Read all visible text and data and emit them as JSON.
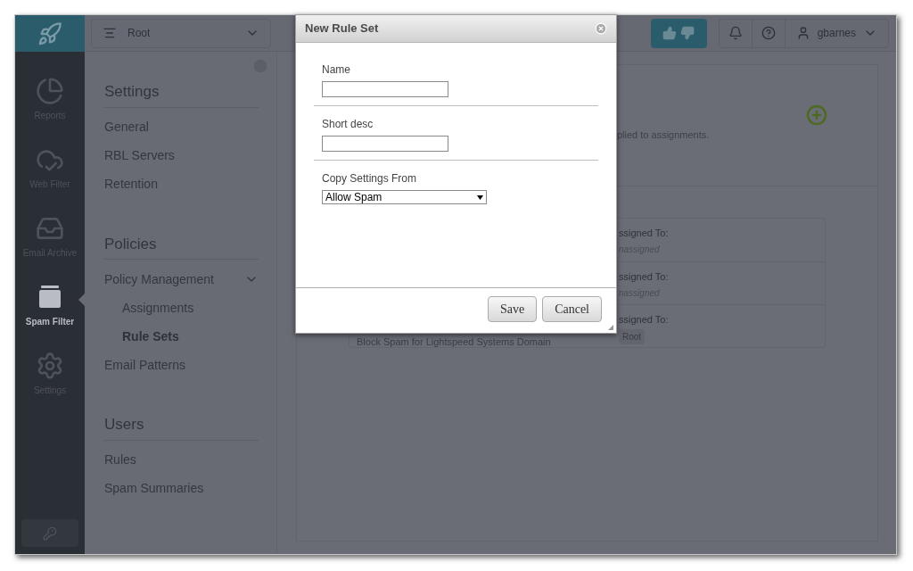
{
  "top_bar": {
    "org_selector": "Root",
    "user": "gbarnes"
  },
  "nav_rail": [
    {
      "label": "Reports",
      "kind": "pie",
      "selected": false
    },
    {
      "label": "Web Filter",
      "kind": "cloud",
      "selected": false
    },
    {
      "label": "Email Archive",
      "kind": "inbox",
      "selected": false
    },
    {
      "label": "Spam Filter",
      "kind": "mailbox",
      "selected": true
    },
    {
      "label": "Settings",
      "kind": "gear",
      "selected": false
    }
  ],
  "sidebar": {
    "sections": [
      {
        "title": "Settings",
        "items": [
          {
            "label": "General",
            "selected": false
          },
          {
            "label": "RBL Servers",
            "selected": false
          },
          {
            "label": "Retention",
            "selected": false
          }
        ]
      },
      {
        "title": "Policies",
        "items": [
          {
            "label": "Policy Management",
            "selected": false,
            "expanded": true,
            "children": [
              {
                "label": "Assignments",
                "selected": false
              },
              {
                "label": "Rule Sets",
                "selected": true
              }
            ]
          },
          {
            "label": "Email Patterns",
            "selected": false
          }
        ]
      },
      {
        "title": "Users",
        "items": [
          {
            "label": "Rules",
            "selected": false
          },
          {
            "label": "Spam Summaries",
            "selected": false
          }
        ]
      }
    ]
  },
  "content": {
    "description": "plied to assignments.",
    "rule_sets": [
      {
        "assigned_label": "ssigned To:",
        "assigned_value": "nassigned",
        "kind": "unassigned"
      },
      {
        "assigned_label": "ssigned To:",
        "assigned_value": "nassigned",
        "kind": "unassigned"
      },
      {
        "name": "Block Spam for Lightspeed Systems Domain",
        "assigned_label": "ssigned To:",
        "assigned_value": "Root",
        "kind": "badge"
      }
    ]
  },
  "dialog": {
    "title": "New Rule Set",
    "fields": [
      {
        "kind": "text",
        "label": "Name"
      },
      {
        "kind": "text",
        "label": "Short desc"
      },
      {
        "kind": "select",
        "label": "Copy Settings From",
        "value": "Allow Spam"
      }
    ],
    "buttons": [
      "Save",
      "Cancel"
    ]
  }
}
